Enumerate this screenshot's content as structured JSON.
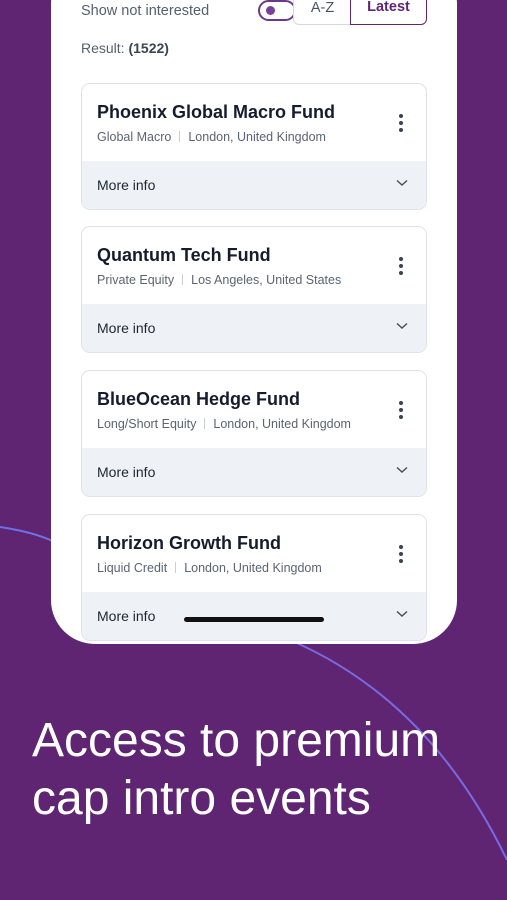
{
  "filters": {
    "toggle_label": "Show not interested",
    "sort_options": [
      "A-Z",
      "Latest"
    ],
    "sort_selected": "Latest"
  },
  "result": {
    "label": "Result:",
    "count": "(1522)"
  },
  "funds": [
    {
      "name": "Phoenix Global Macro Fund",
      "strategy": "Global Macro",
      "location": "London, United Kingdom",
      "more_info": "More info"
    },
    {
      "name": "Quantum Tech Fund",
      "strategy": "Private Equity",
      "location": "Los Angeles, United States",
      "more_info": "More info"
    },
    {
      "name": "BlueOcean Hedge Fund",
      "strategy": "Long/Short Equity",
      "location": "London, United Kingdom",
      "more_info": "More info"
    },
    {
      "name": "Horizon Growth Fund",
      "strategy": "Liquid Credit",
      "location": "London, United Kingdom",
      "more_info": "More info"
    }
  ],
  "headline": {
    "line1": "Access to premium",
    "line2": "cap intro events"
  },
  "icons": {
    "card_menu": "kebab-menu-icon",
    "expand": "chevron-down-icon"
  },
  "colors": {
    "background": "#5f2573",
    "accent": "#5f2573",
    "arc": "#7a6ae0"
  }
}
